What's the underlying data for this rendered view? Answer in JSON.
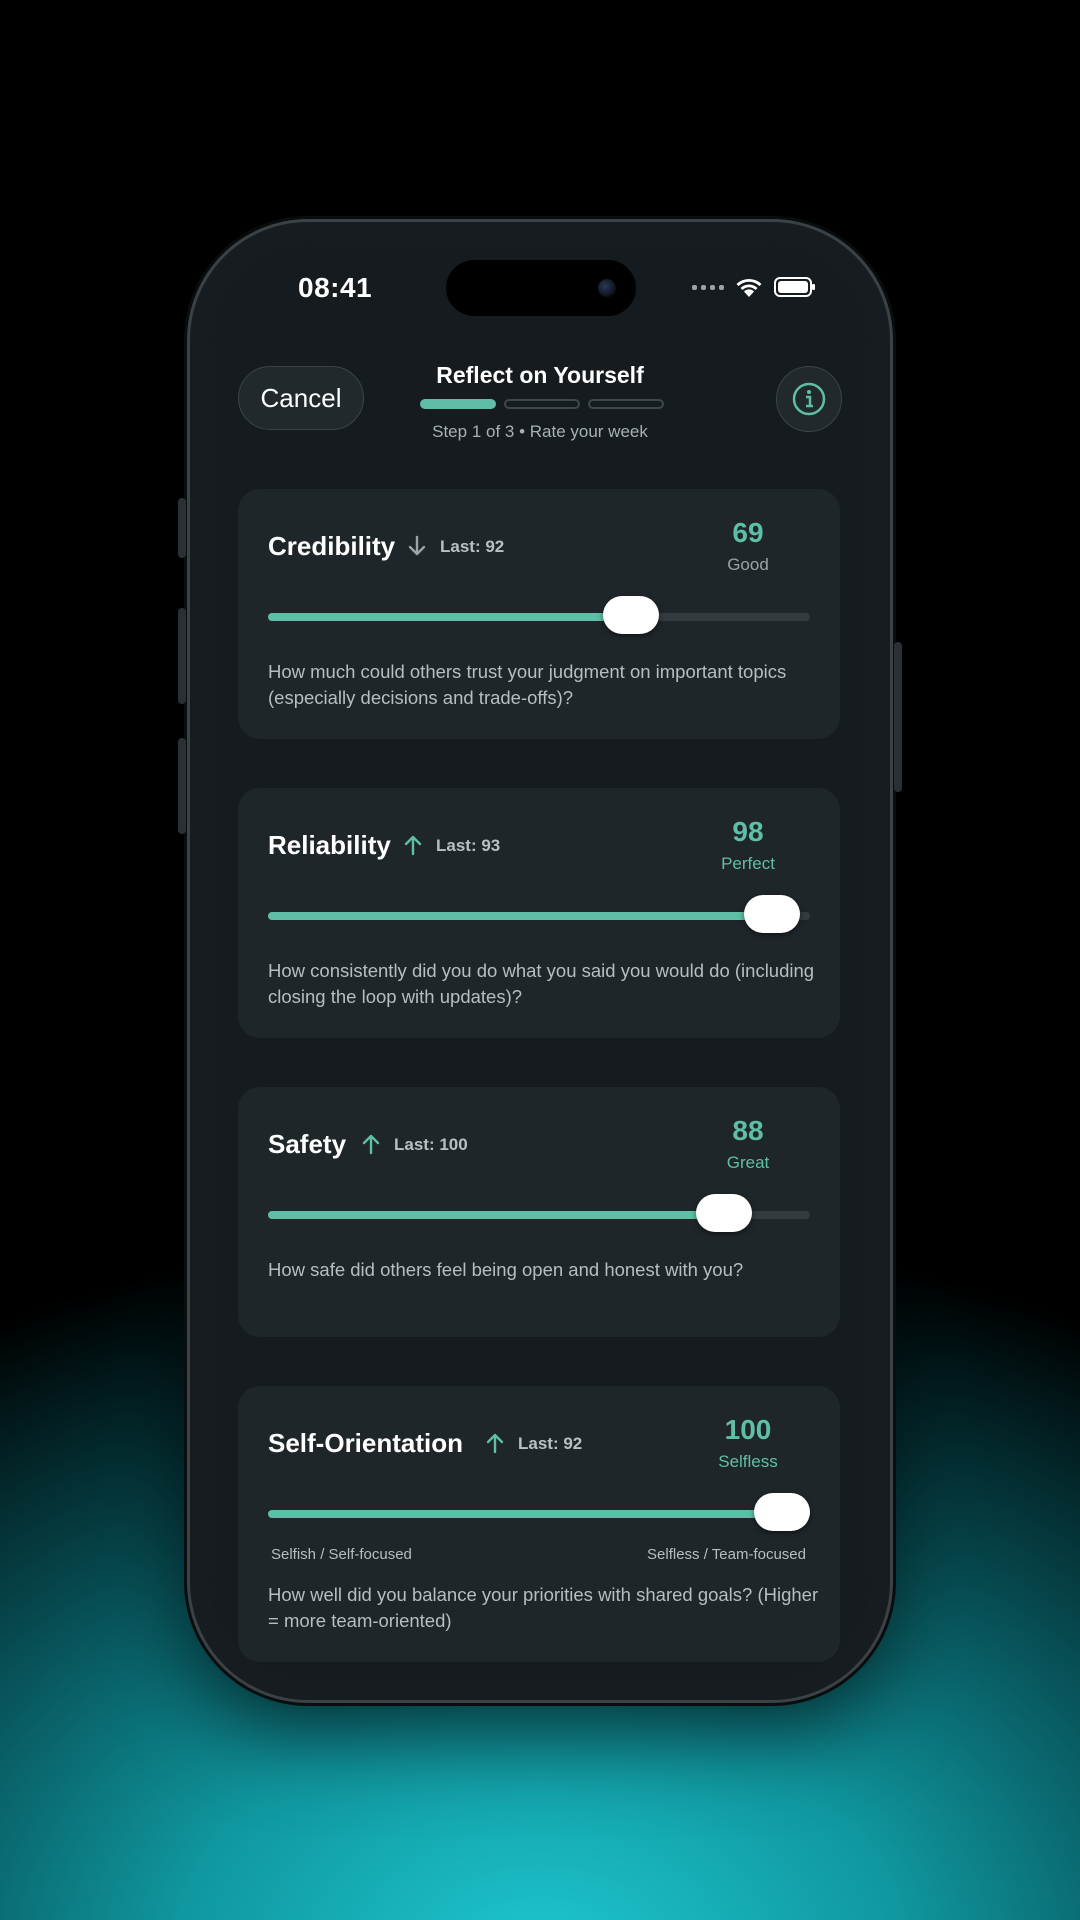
{
  "status": {
    "time": "08:41"
  },
  "header": {
    "cancel_label": "Cancel",
    "title": "Reflect on Yourself",
    "subtitle": "Step 1 of 3 • Rate your week",
    "current_step": 1,
    "total_steps": 3
  },
  "colors": {
    "accent": "#5fbfa6",
    "card": "#1f262a",
    "background": "#151b1e"
  },
  "cards": [
    {
      "name": "Credibility",
      "trend": "down-arrow-icon",
      "last": "Last: 92",
      "score": "69",
      "rating": "Good",
      "value": 69,
      "question": "How much could others trust your judgment on important topics (especially decisions and trade-offs)?"
    },
    {
      "name": "Reliability",
      "trend": "up-arrow-icon",
      "last": "Last: 93",
      "score": "98",
      "rating": "Perfect",
      "value": 98,
      "question": "How consistently did you do what you said you would do (including closing the loop with updates)?"
    },
    {
      "name": "Safety",
      "trend": "up-arrow-icon",
      "last": "Last: 100",
      "score": "88",
      "rating": "Great",
      "value": 88,
      "question": "How safe did others feel being open and honest with you?"
    },
    {
      "name": "Self-Orientation",
      "trend": "up-arrow-icon",
      "last": "Last: 92",
      "score": "100",
      "rating": "Selfless",
      "value": 100,
      "range_left": "Selfish / Self-focused",
      "range_right": "Selfless / Team-focused",
      "question": "How well did you balance your priorities with shared goals? (Higher = more team-oriented)"
    }
  ]
}
